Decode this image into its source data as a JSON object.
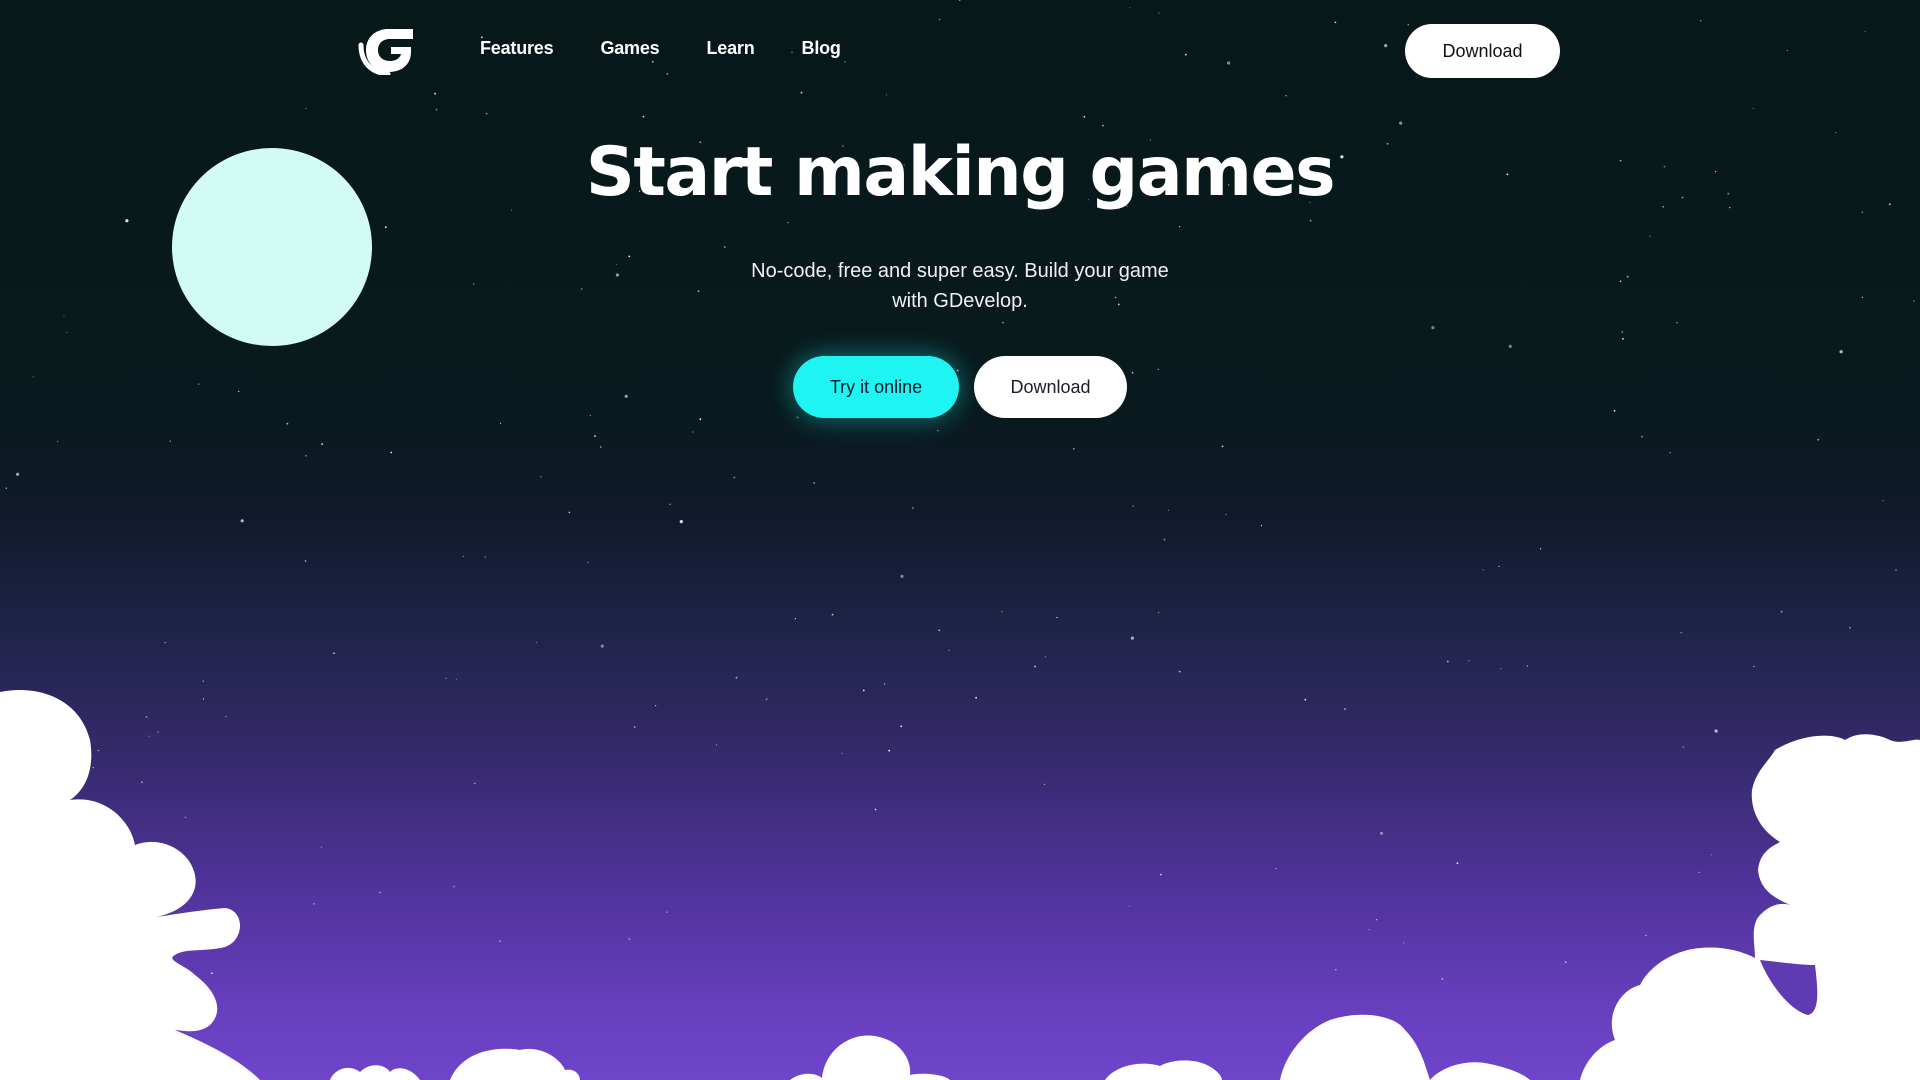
{
  "header": {
    "logo_icon": "gdevelop-logo-icon",
    "nav_items": [
      "Features",
      "Games",
      "Learn",
      "Blog"
    ],
    "download_label": "Download"
  },
  "hero": {
    "title": "Start making games",
    "subtitle": "No-code, free and super easy. Build your game with GDevelop.",
    "try_online_label": "Try it online",
    "download_label": "Download"
  },
  "colors": {
    "accent": "#1ef5f2",
    "moon": "#d3fbf5",
    "sky_top": "#071819",
    "sky_bottom": "#6e44c9",
    "cloud": "#ffffff"
  }
}
